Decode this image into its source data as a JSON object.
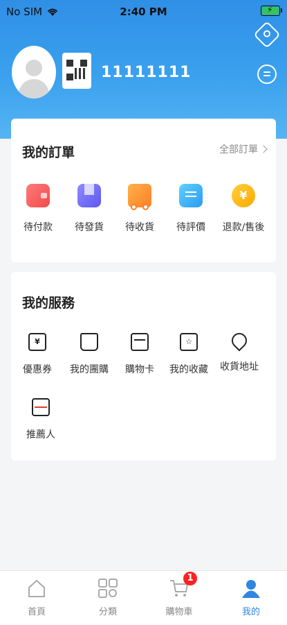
{
  "status_bar": {
    "carrier": "No SIM",
    "time": "2:40 PM"
  },
  "profile": {
    "username": "11111111"
  },
  "orders": {
    "title": "我的訂單",
    "all_orders": "全部訂單",
    "items": [
      {
        "label": "待付款",
        "icon": "wallet-icon"
      },
      {
        "label": "待發貨",
        "icon": "package-icon"
      },
      {
        "label": "待收貨",
        "icon": "truck-icon"
      },
      {
        "label": "待評價",
        "icon": "comment-icon"
      },
      {
        "label": "退款/售後",
        "icon": "refund-icon"
      }
    ]
  },
  "services": {
    "title": "我的服務",
    "items": [
      {
        "label": "優惠券",
        "icon": "coupon-icon"
      },
      {
        "label": "我的團購",
        "icon": "group-buy-icon"
      },
      {
        "label": "購物卡",
        "icon": "card-icon"
      },
      {
        "label": "我的收藏",
        "icon": "favorite-folder-icon"
      },
      {
        "label": "收貨地址",
        "icon": "location-icon"
      },
      {
        "label": "推薦人",
        "icon": "referrer-icon"
      }
    ]
  },
  "tabbar": {
    "items": [
      {
        "label": "首頁",
        "icon": "home-icon"
      },
      {
        "label": "分類",
        "icon": "category-icon"
      },
      {
        "label": "購物車",
        "icon": "cart-icon"
      },
      {
        "label": "我的",
        "icon": "profile-icon"
      }
    ],
    "cart_badge": "1"
  },
  "colors": {
    "primary": "#2f8fe6",
    "active_tab": "#2f86e2",
    "badge": "#ff2222"
  }
}
